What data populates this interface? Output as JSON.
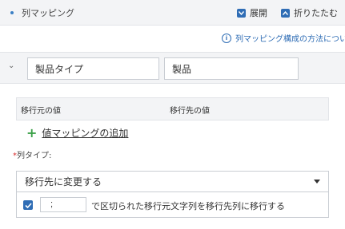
{
  "header": {
    "title": "列マッピング",
    "expand_label": "展開",
    "collapse_label": "折りたたむ"
  },
  "help_link": "列マッピング構成の方法について",
  "mapping": {
    "source_column": "製品タイプ",
    "target_column": "製品"
  },
  "value_table": {
    "columns": [
      "移行元の値",
      "移行先の値"
    ]
  },
  "add_value_mapping_label": "値マッピングの追加",
  "column_type": {
    "label": "列タイプ:",
    "selected": "移行先に変更する"
  },
  "delimiter_option": {
    "checked": true,
    "delimiter_value": ";",
    "text": "で区切られた移行元文字列を移行先列に移行する"
  },
  "colors": {
    "accent": "#2f6db5",
    "add_icon": "#3aa047",
    "required": "#d62d2d",
    "panel_bg": "#f3f4f6"
  }
}
